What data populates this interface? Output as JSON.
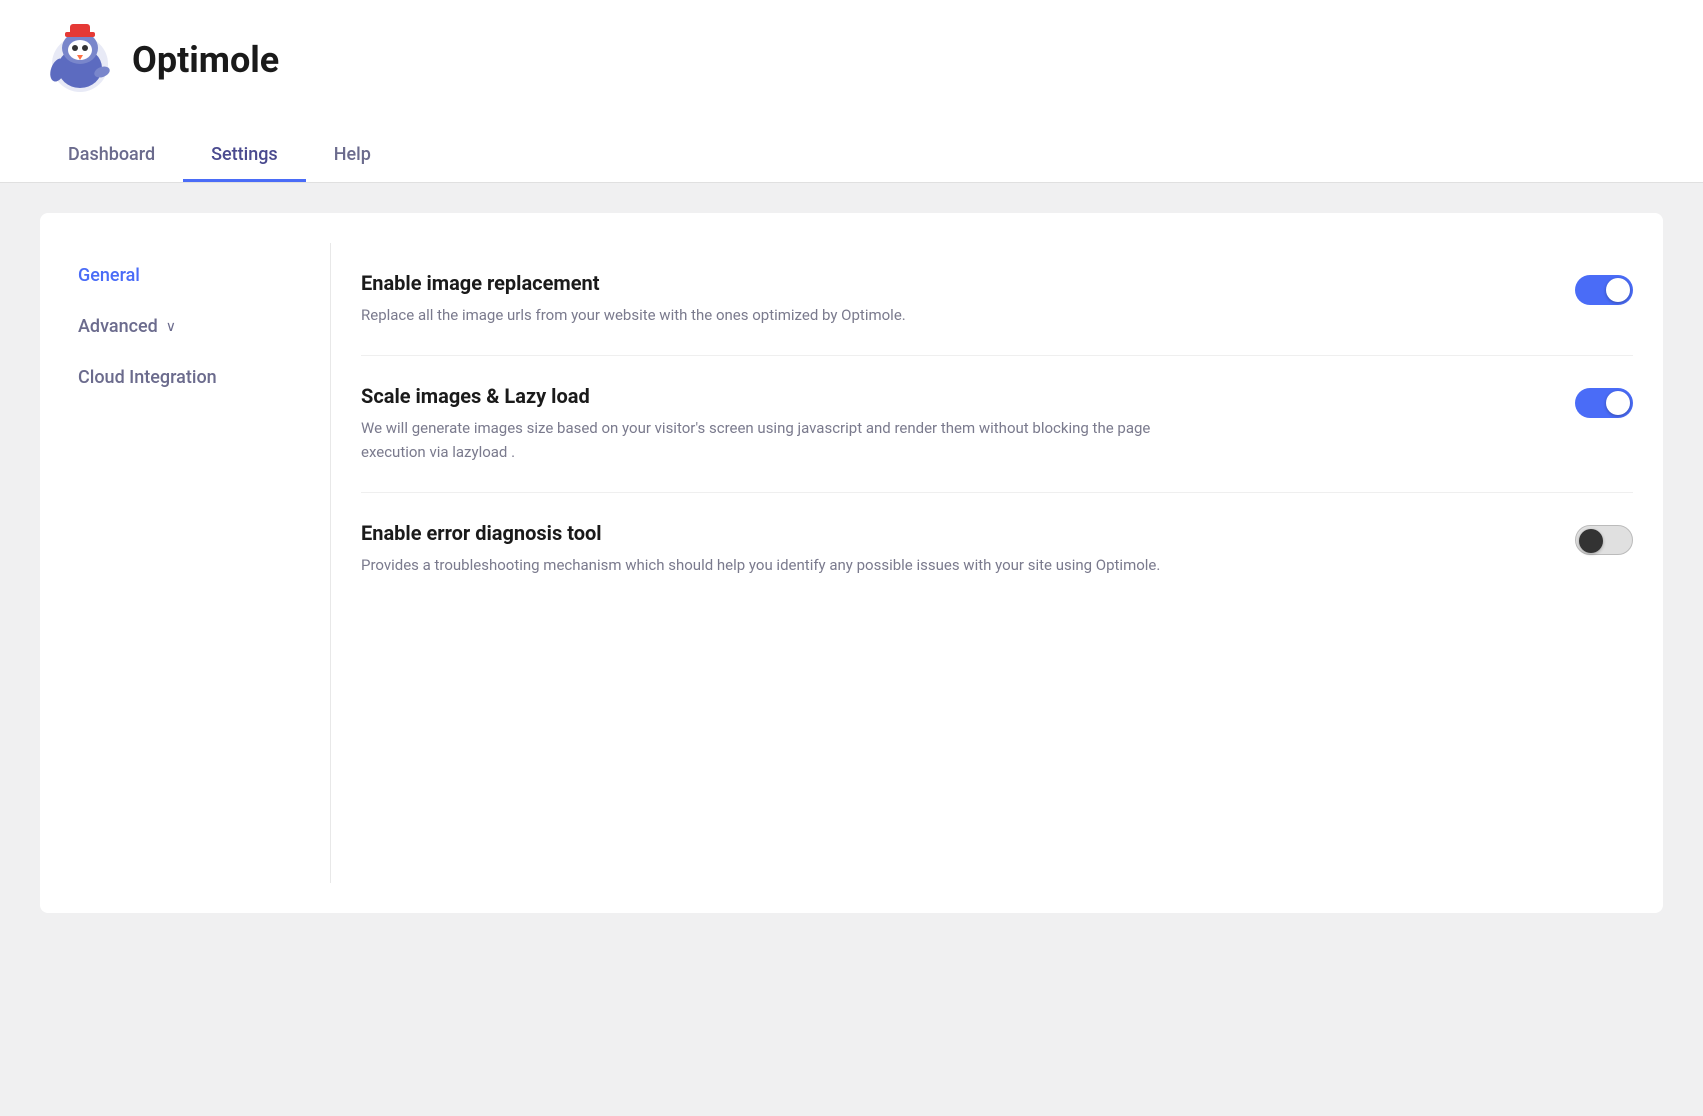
{
  "app": {
    "name": "Optimole"
  },
  "nav": {
    "tabs": [
      {
        "id": "dashboard",
        "label": "Dashboard",
        "active": false
      },
      {
        "id": "settings",
        "label": "Settings",
        "active": true
      },
      {
        "id": "help",
        "label": "Help",
        "active": false
      }
    ]
  },
  "sidebar": {
    "items": [
      {
        "id": "general",
        "label": "General",
        "active": true,
        "hasChevron": false
      },
      {
        "id": "advanced",
        "label": "Advanced",
        "active": false,
        "hasChevron": true
      },
      {
        "id": "cloud-integration",
        "label": "Cloud Integration",
        "active": false,
        "hasChevron": false
      }
    ]
  },
  "settings": {
    "rows": [
      {
        "id": "image-replacement",
        "title": "Enable image replacement",
        "description": "Replace all the image urls from your website with the ones optimized by Optimole.",
        "toggle": "on"
      },
      {
        "id": "scale-lazy",
        "title": "Scale images & Lazy load",
        "description": "We will generate images size based on your visitor's screen using javascript and render them without blocking the page execution via lazyload .",
        "toggle": "on"
      },
      {
        "id": "error-diagnosis",
        "title": "Enable error diagnosis tool",
        "description": "Provides a troubleshooting mechanism which should help you identify any possible issues with your site using Optimole.",
        "toggle": "off"
      }
    ]
  },
  "chevron": "∨"
}
